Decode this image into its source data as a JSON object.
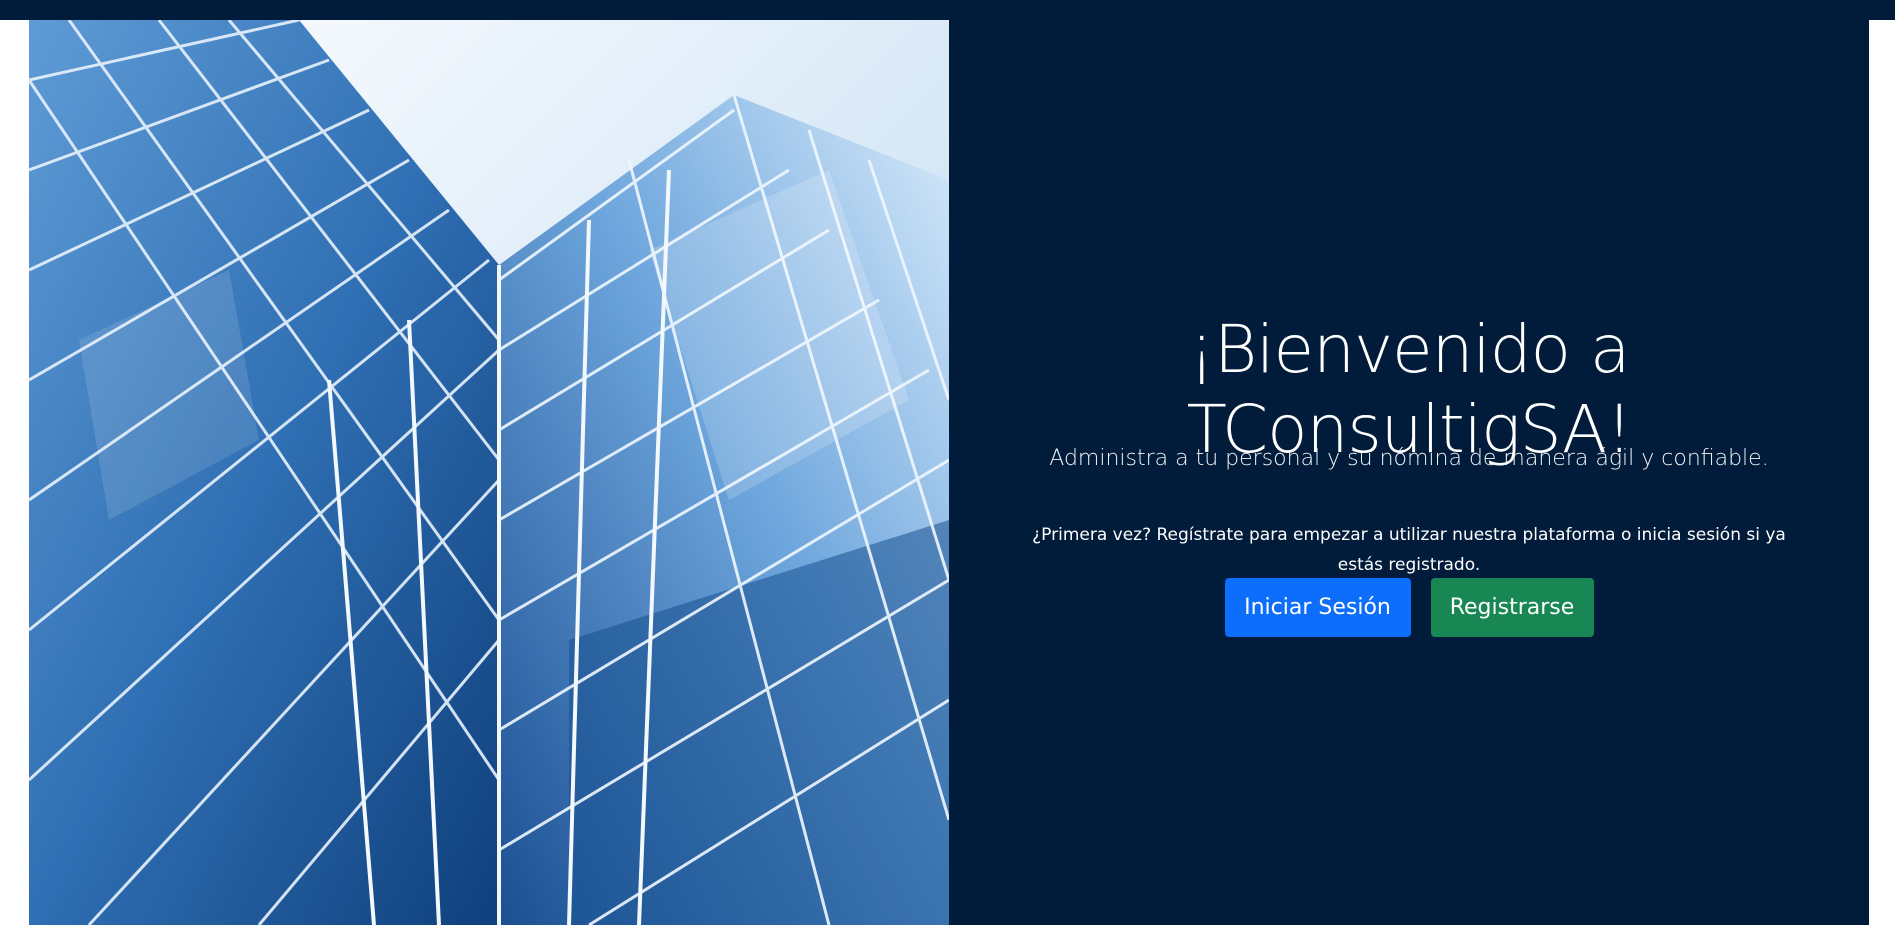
{
  "colors": {
    "background": "#001c3a",
    "login_button": "#0d6efd",
    "register_button": "#198754"
  },
  "hero": {
    "icon": "glass-building-image"
  },
  "welcome": {
    "title": "¡Bienvenido a TConsultigSA!",
    "subtitle": "Administra a tu personal y su nómina de manera ágil y confiable.",
    "note": "¿Primera vez? Regístrate para empezar a utilizar nuestra plataforma o inicia sesión si ya estás registrado."
  },
  "actions": {
    "login_label": "Iniciar Sesión",
    "register_label": "Registrarse"
  }
}
